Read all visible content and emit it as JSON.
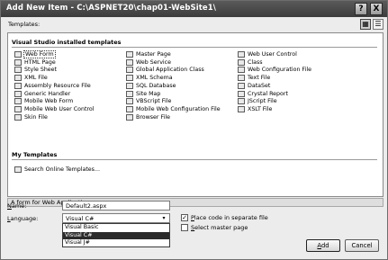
{
  "window": {
    "title": "Add New Item - C:\\ASPNET20\\chap01-WebSite1\\",
    "help_glyph": "?",
    "close_glyph": "X"
  },
  "templates_label": "Templates:",
  "view_buttons": {
    "large_icons": "▦",
    "small_icons": "☰"
  },
  "installed": {
    "header": "Visual Studio installed templates",
    "columns": [
      [
        "Web Form",
        "HTML Page",
        "Style Sheet",
        "XML File",
        "Assembly Resource File",
        "Generic Handler",
        "Mobile Web Form",
        "Mobile Web User Control",
        "Skin File"
      ],
      [
        "Master Page",
        "Web Service",
        "Global Application Class",
        "XML Schema",
        "SQL Database",
        "Site Map",
        "VBScript File",
        "Mobile Web Configuration File",
        "Browser File"
      ],
      [
        "Web User Control",
        "Class",
        "Web Configuration File",
        "Text File",
        "DataSet",
        "Crystal Report",
        "JScript File",
        "XSLT File"
      ]
    ],
    "selected": "Web Form"
  },
  "my_templates": {
    "header": "My Templates",
    "items": [
      "Search Online Templates..."
    ]
  },
  "description": "A form for Web Applications",
  "name_field": {
    "label_underlined": "N",
    "label_rest": "ame:",
    "value": "Default2.aspx"
  },
  "language_field": {
    "label_underlined": "L",
    "label_rest": "anguage:",
    "value": "Visual C#",
    "options": [
      "Visual Basic",
      "Visual C#",
      "Visual J#"
    ],
    "highlighted": "Visual C#"
  },
  "checkboxes": {
    "place_code": {
      "label_underlined": "P",
      "label_rest": "lace code in separate file",
      "checked": true,
      "mark": "✓"
    },
    "select_master": {
      "label_underlined": "S",
      "label_rest": "elect master page",
      "checked": false,
      "mark": ""
    }
  },
  "buttons": {
    "add": {
      "label_underlined": "A",
      "label_rest": "dd"
    },
    "cancel": {
      "label": "Cancel"
    }
  }
}
